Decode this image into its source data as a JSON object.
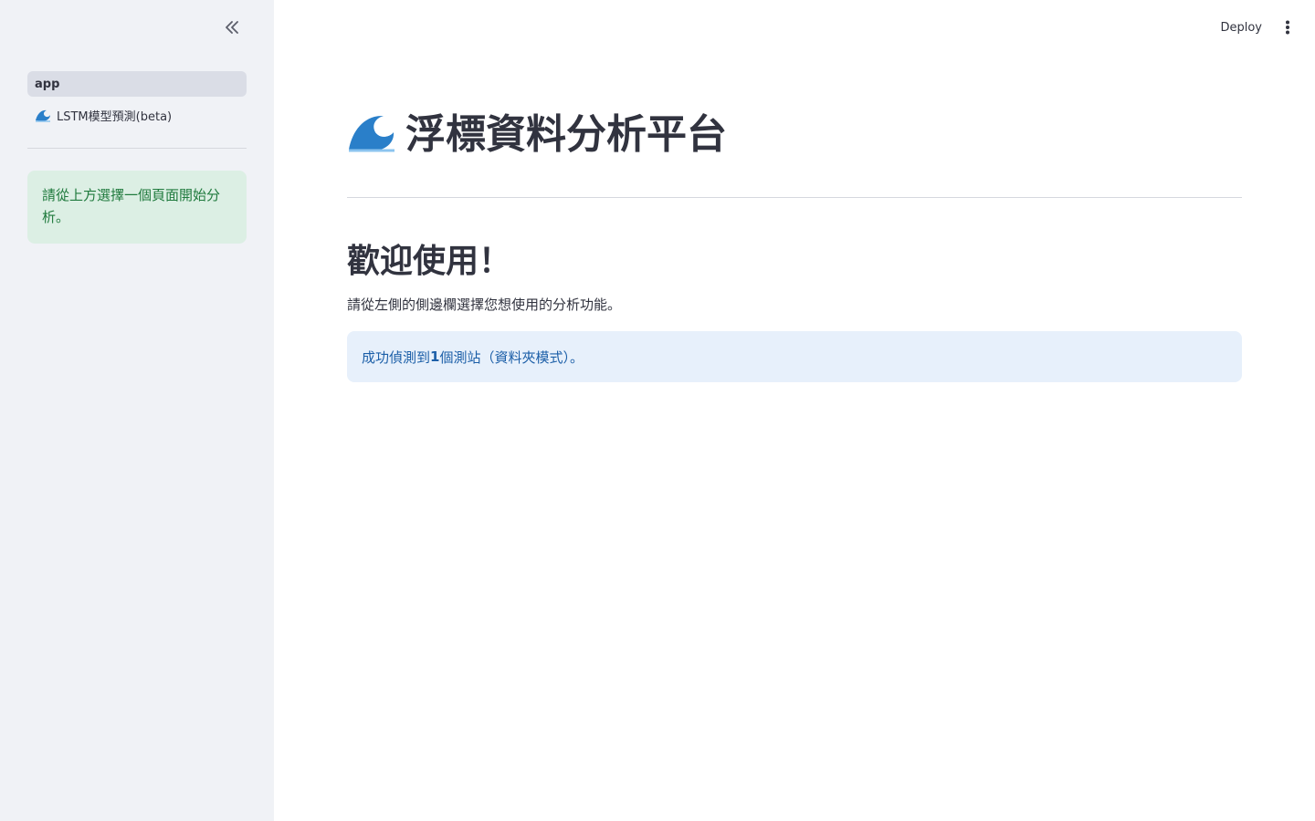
{
  "sidebar": {
    "collapse_icon": "double-chevron-left-icon",
    "nav": [
      {
        "label": "app",
        "active": true
      },
      {
        "label": "LSTM模型預測(beta)",
        "icon": "wave-icon",
        "active": false
      }
    ],
    "success_message": "請從上方選擇一個頁面開始分析。"
  },
  "topbar": {
    "deploy_label": "Deploy",
    "menu_icon": "vertical-dots-icon"
  },
  "main": {
    "title": "浮標資料分析平台",
    "title_icon": "wave-icon",
    "welcome_heading": "歡迎使用！",
    "description": "請從左側的側邊欄選擇您想使用的分析功能。",
    "info": {
      "prefix": "成功偵測到 ",
      "count": "1",
      "suffix": " 個測站（資料夾模式）。"
    }
  },
  "colors": {
    "sidebar_bg": "#f0f2f6",
    "success_bg": "#dcefe4",
    "success_text": "#1f7a3d",
    "info_bg": "#e7f0fb",
    "info_text": "#1c5fa8"
  }
}
